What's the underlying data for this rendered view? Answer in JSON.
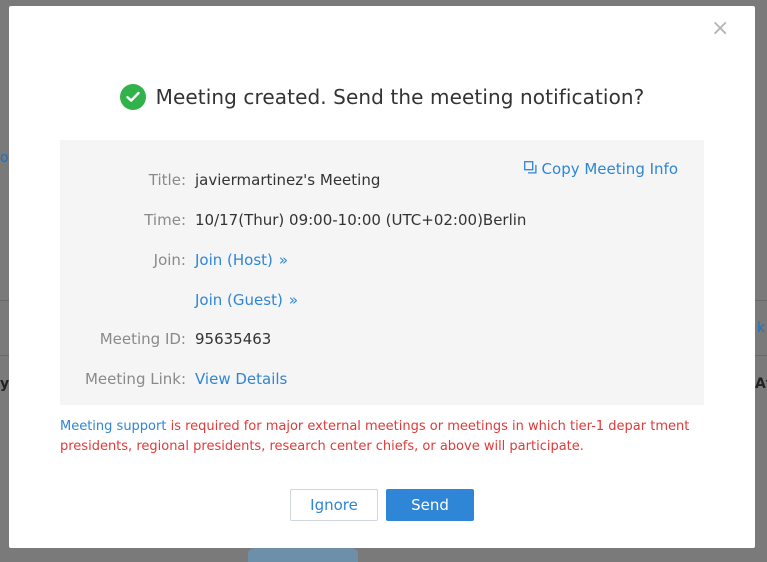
{
  "background": {
    "left_link_fragment": "op",
    "left_text_fragment": "y",
    "right_text_fragment": "At",
    "right_link_fragment": "k"
  },
  "dialog": {
    "close_icon": "close-icon",
    "headline": "Meeting created. Send the meeting notification?",
    "success_color": "#32b24a",
    "copy_label": "Copy Meeting Info",
    "fields": {
      "title_label": "Title:",
      "title_value": "javiermartinez's Meeting",
      "time_label": "Time:",
      "time_value": "10/17(Thur) 09:00-10:00 (UTC+02:00)Berlin",
      "join_label": "Join:",
      "join_host": "Join (Host)",
      "join_guest": "Join (Guest)",
      "meeting_id_label": "Meeting ID:",
      "meeting_id_value": "95635463",
      "meeting_link_label": "Meeting Link:",
      "meeting_link_value": "View Details"
    },
    "notice": {
      "highlight": "Meeting support",
      "text": " is required for major external meetings or meetings in which tier-1 depar tment presidents, regional presidents, research center chiefs, or above will participate."
    },
    "buttons": {
      "ignore": "Ignore",
      "send": "Send"
    },
    "accent_color": "#2f86d6",
    "warning_color": "#e03a3a"
  }
}
